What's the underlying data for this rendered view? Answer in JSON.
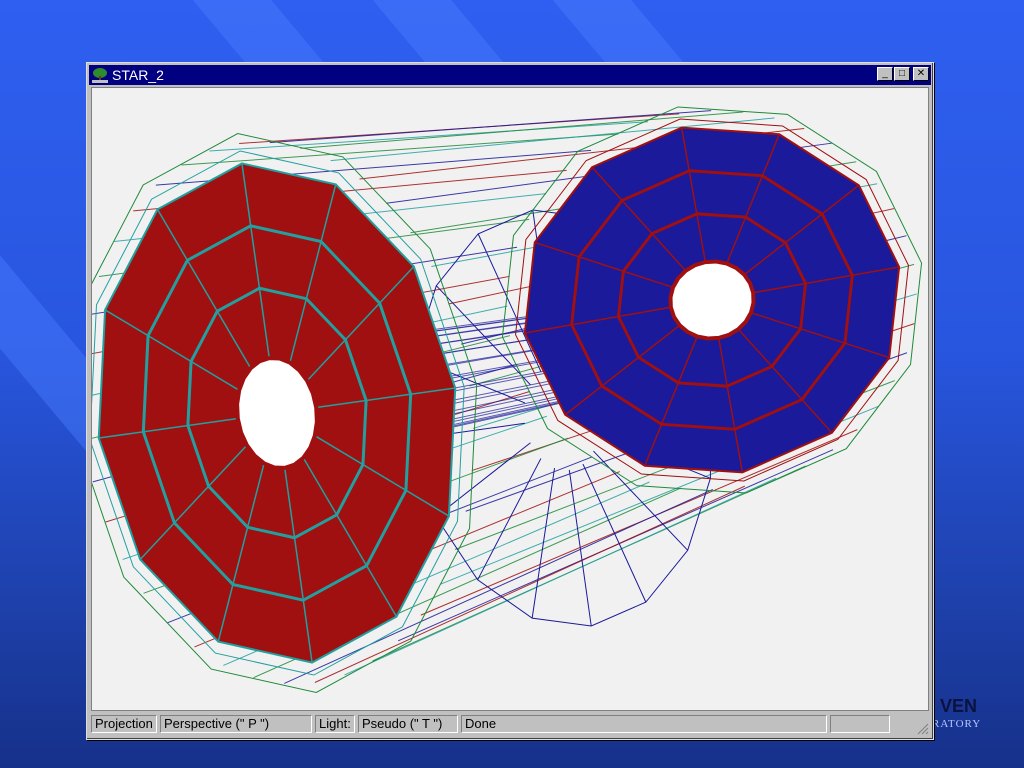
{
  "window": {
    "title": "STAR_2",
    "controls": {
      "minimize_glyph": "_",
      "maximize_glyph": "□",
      "close_glyph": "✕"
    },
    "app_icon": "root-tree-icon"
  },
  "statusbar": {
    "projection_label": "Projection",
    "projection_value": "Perspective (\" P \")",
    "light_label": "Light:",
    "light_value": "Pseudo (\" T \")",
    "status": "Done",
    "empty": ""
  },
  "logo": {
    "top": "VEN",
    "bottom": "RATORY"
  },
  "colors": {
    "background": "#2856df",
    "titlebar": "#000080",
    "detector_red": "#a01010",
    "detector_blue": "#1a1a9a",
    "wire_green": "#1f8a3a",
    "wire_cyan": "#22a0a0"
  }
}
